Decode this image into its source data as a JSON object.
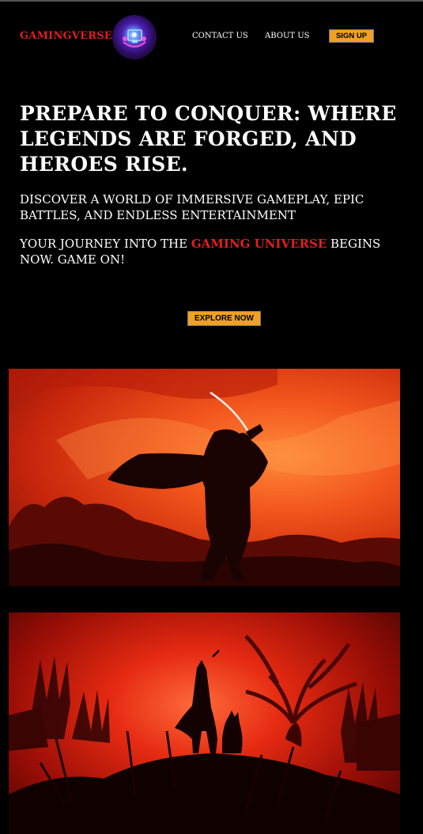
{
  "header": {
    "brand": "GAMINGVERSE",
    "logo_icon": "gamer-emblem-icon",
    "nav": {
      "contact": "CONTACT US",
      "about": "ABOUT US"
    },
    "signup_label": "SIGN UP"
  },
  "hero": {
    "title": "PREPARE TO CONQUER: WHERE LEGENDS ARE FORGED, AND HEROES RISE.",
    "subtitle": "DISCOVER A WORLD OF IMMERSIVE GAMEPLAY, EPIC BATTLES, AND ENDLESS ENTERTAINMENT",
    "journey_prefix": "YOUR JOURNEY INTO THE ",
    "journey_highlight": "GAMING UNIVERSE",
    "journey_suffix": " BEGINS NOW. GAME ON!",
    "cta_label": "EXPLORE NOW"
  },
  "gallery": [
    {
      "subject": "samurai-silhouette-red-sky"
    },
    {
      "subject": "warrior-with-wolf-battlefield"
    }
  ],
  "colors": {
    "background": "#000000",
    "brand_red": "#e0201c",
    "button_orange": "#f0a024",
    "text": "#ffffff"
  }
}
